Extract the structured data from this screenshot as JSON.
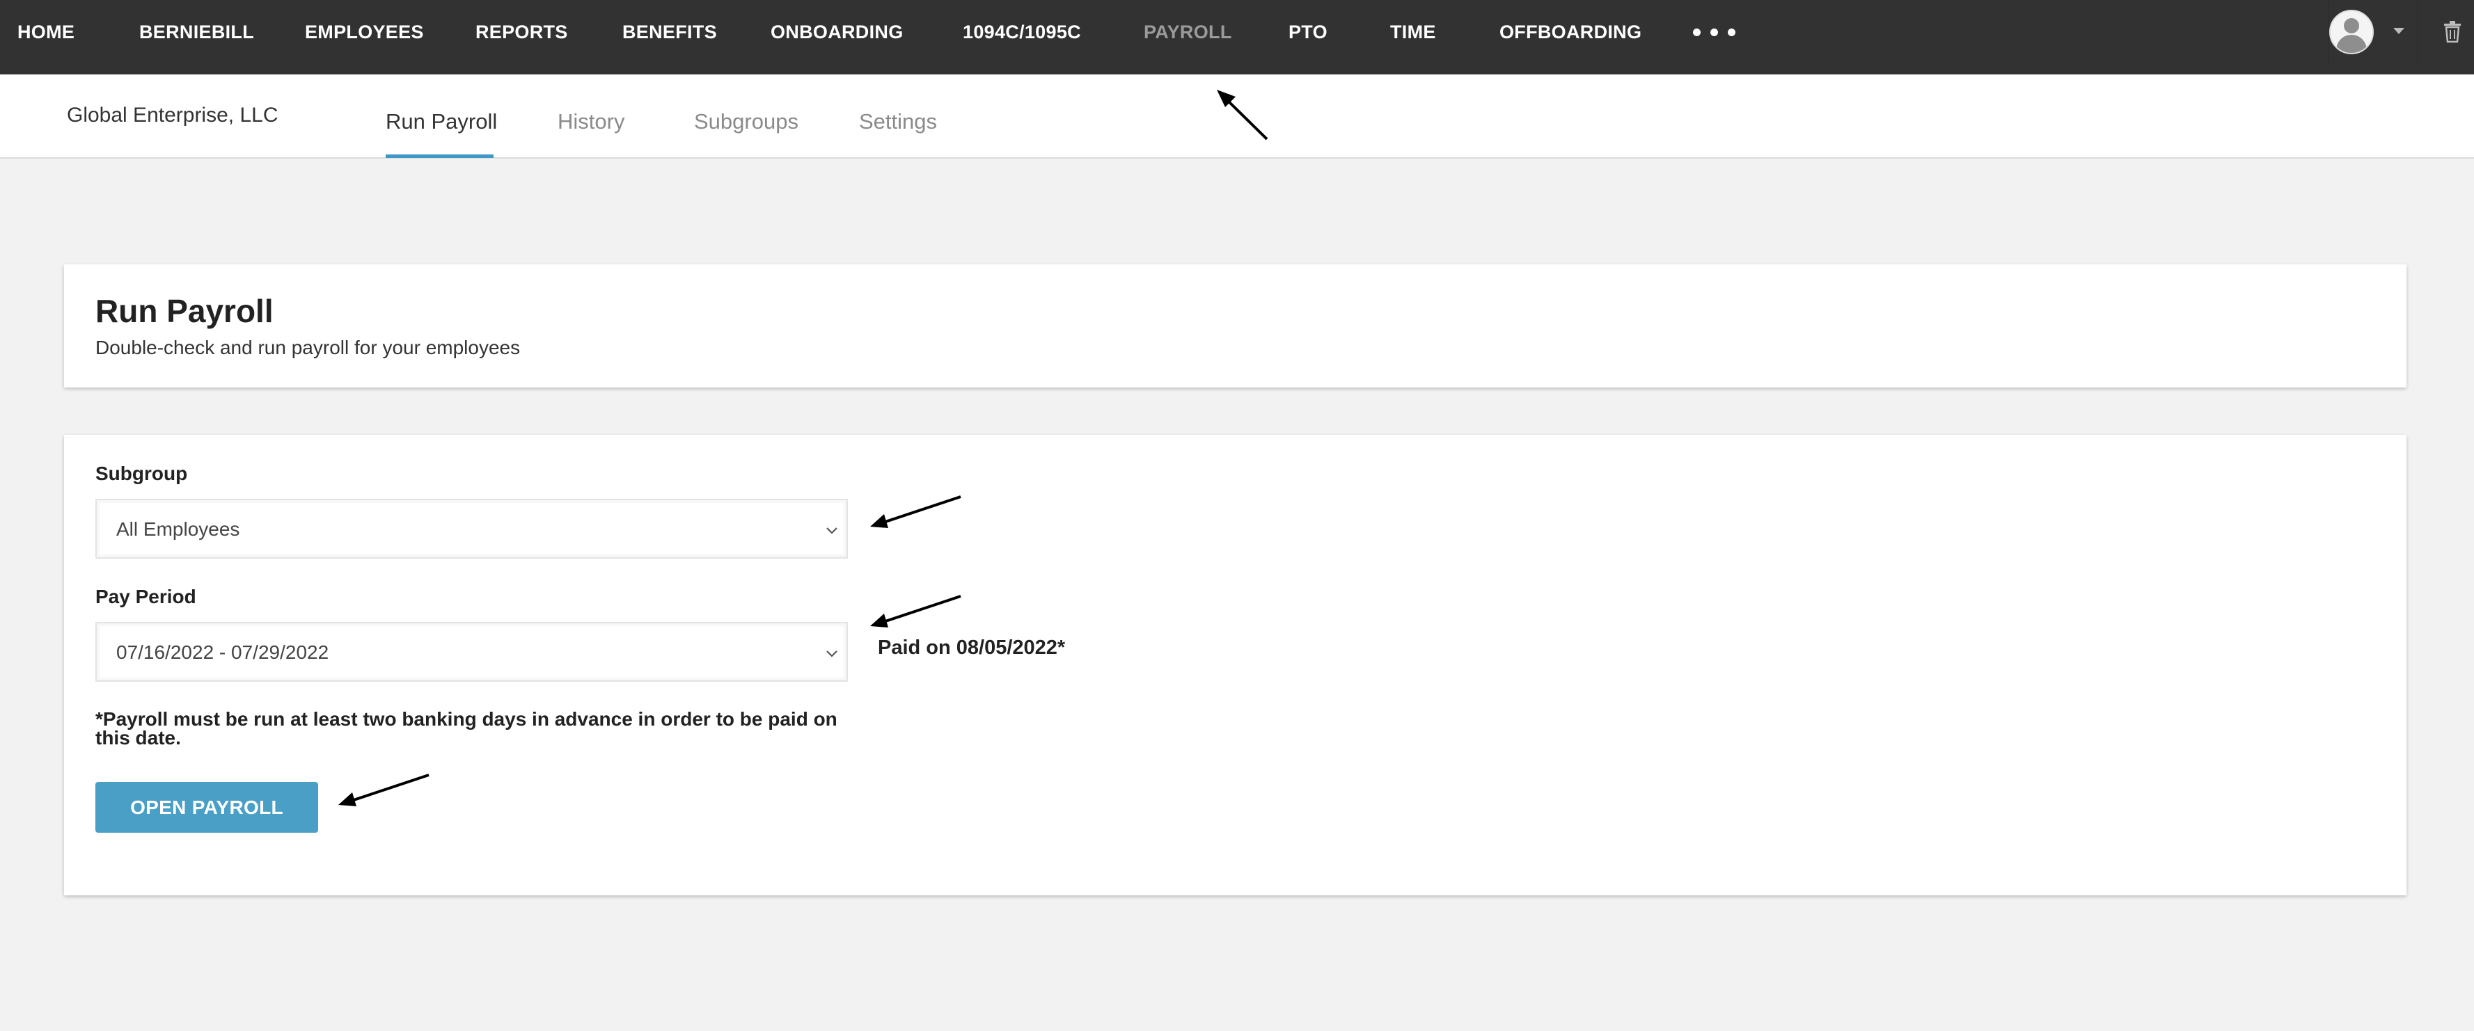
{
  "nav": {
    "items": [
      {
        "label": "HOME",
        "active": false
      },
      {
        "label": "BERNIEBILL",
        "active": false
      },
      {
        "label": "EMPLOYEES",
        "active": false
      },
      {
        "label": "REPORTS",
        "active": false
      },
      {
        "label": "BENEFITS",
        "active": false
      },
      {
        "label": "ONBOARDING",
        "active": false
      },
      {
        "label": "1094C/1095C",
        "active": false
      },
      {
        "label": "PAYROLL",
        "active": true
      },
      {
        "label": "PTO",
        "active": false
      },
      {
        "label": "TIME",
        "active": false
      },
      {
        "label": "OFFBOARDING",
        "active": false
      }
    ],
    "more_icon": "more-dots-icon",
    "user_icon": "avatar-icon",
    "trash_icon": "trash-icon"
  },
  "subheader": {
    "company": "Global Enterprise, LLC",
    "tabs": [
      {
        "label": "Run Payroll",
        "active": true
      },
      {
        "label": "History",
        "active": false
      },
      {
        "label": "Subgroups",
        "active": false
      },
      {
        "label": "Settings",
        "active": false
      }
    ]
  },
  "intro": {
    "title": "Run Payroll",
    "subtitle": "Double-check and run payroll for your employees"
  },
  "form": {
    "subgroup_label": "Subgroup",
    "subgroup_value": "All Employees",
    "pay_period_label": "Pay Period",
    "pay_period_value": "07/16/2022 - 07/29/2022",
    "paid_on": "Paid on 08/05/2022*",
    "note": "*Payroll must be run at least two banking days in advance in order to be paid on this date.",
    "open_button": "OPEN PAYROLL"
  },
  "colors": {
    "nav_bg": "#323232",
    "accent": "#3f97c4",
    "button": "#4a9fc6",
    "page_bg": "#f2f2f2"
  }
}
